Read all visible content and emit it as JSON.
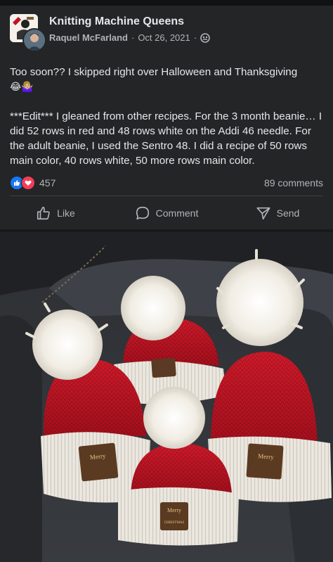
{
  "post": {
    "group_name": "Knitting Machine Queens",
    "author": "Raquel McFarland",
    "date": "Oct 26, 2021",
    "separator": "·",
    "audience_icon": "group-icon",
    "text_line1": "Too soon?? I skipped right over Halloween and Thanksgiving",
    "emojis": "😂🤷🏼‍♀️",
    "text_edit": "***Edit*** I gleaned from other recipes. For the 3 month beanie… I did 52 rows in red and 48 rows white on the Addi 46 needle. For the adult beanie, I used the Sentro 48. I did a recipe of 50 rows main color, 40 rows white, 50 more rows main color.",
    "reaction_count": "457",
    "comments": "89 comments"
  },
  "actions": {
    "like": "Like",
    "comment": "Comment",
    "send": "Send"
  },
  "photo": {
    "label_text_1": "Merry",
    "label_text_2": "CHRISTMAS"
  },
  "colors": {
    "background": "#18191a",
    "card": "#242526",
    "text": "#e4e6eb",
    "muted": "#b0b3b8",
    "like_blue": "#1877f2",
    "love_red": "#f33e58",
    "hat_red": "#c1121f",
    "cuff_white": "#e9e5dd"
  }
}
